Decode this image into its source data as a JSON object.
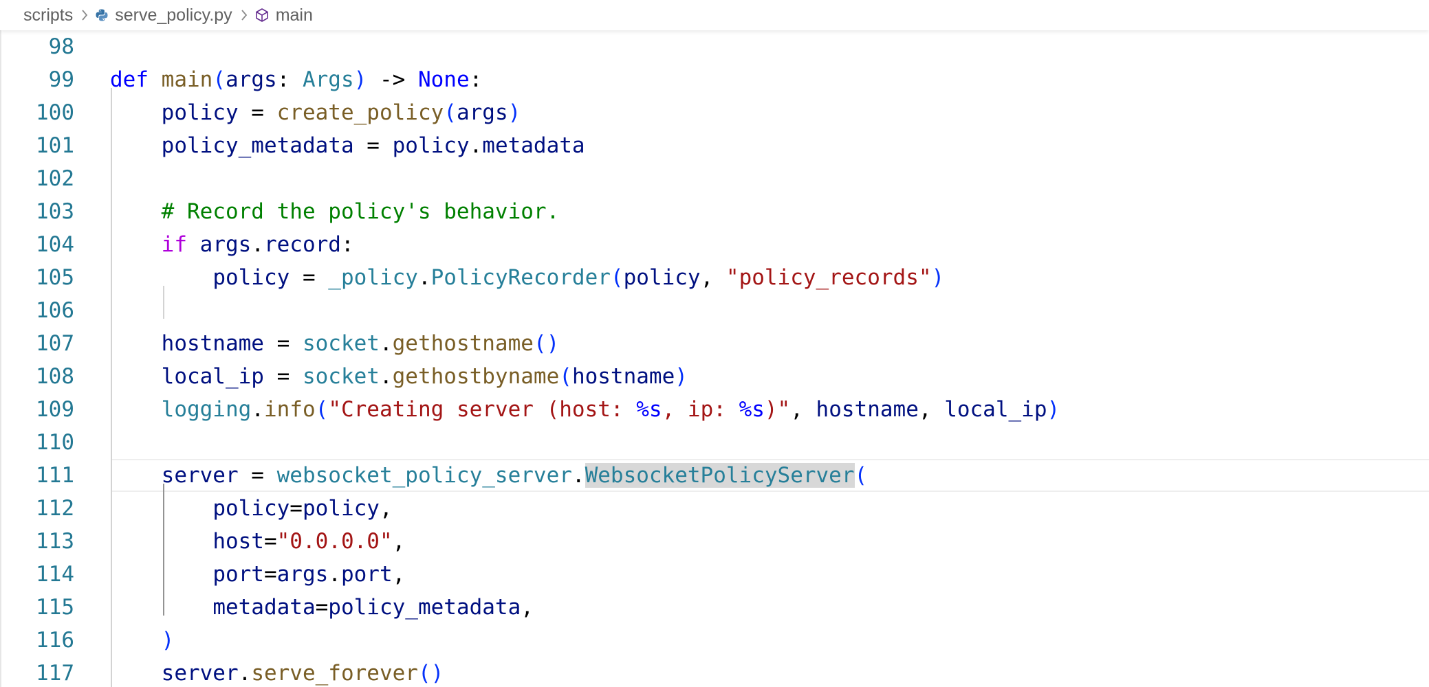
{
  "breadcrumb": {
    "items": [
      {
        "label": "scripts",
        "icon": "folder",
        "icon_glyph": ""
      },
      {
        "label": "serve_policy.py",
        "icon": "python-file-icon"
      },
      {
        "label": "main",
        "icon": "symbol-method-icon"
      }
    ],
    "separator_icon": "chevron-right-icon"
  },
  "editor": {
    "language": "python",
    "current_line": "111",
    "highlighted_token": "WebsocketPolicyServer",
    "colors": {
      "keyword": "#0000ff",
      "control_keyword": "#af00db",
      "function": "#795e26",
      "variable": "#001080",
      "type": "#267f99",
      "string": "#a31515",
      "comment": "#008000",
      "line_number": "#237893"
    },
    "lines": [
      {
        "number": "98",
        "tokens": []
      },
      {
        "number": "99",
        "tokens": [
          {
            "t": "def",
            "c": "kw"
          },
          {
            "t": " ",
            "c": "plain"
          },
          {
            "t": "main",
            "c": "fn"
          },
          {
            "t": "(",
            "c": "b1"
          },
          {
            "t": "args",
            "c": "var"
          },
          {
            "t": ": ",
            "c": "plain"
          },
          {
            "t": "Args",
            "c": "type"
          },
          {
            "t": ")",
            "c": "b1"
          },
          {
            "t": " -> ",
            "c": "plain"
          },
          {
            "t": "None",
            "c": "kw"
          },
          {
            "t": ":",
            "c": "plain"
          }
        ]
      },
      {
        "number": "100",
        "tokens": [
          {
            "t": "    ",
            "c": "plain"
          },
          {
            "t": "policy",
            "c": "var"
          },
          {
            "t": " = ",
            "c": "plain"
          },
          {
            "t": "create_policy",
            "c": "fn"
          },
          {
            "t": "(",
            "c": "b1"
          },
          {
            "t": "args",
            "c": "var"
          },
          {
            "t": ")",
            "c": "b1"
          }
        ]
      },
      {
        "number": "101",
        "tokens": [
          {
            "t": "    ",
            "c": "plain"
          },
          {
            "t": "policy_metadata",
            "c": "var"
          },
          {
            "t": " = ",
            "c": "plain"
          },
          {
            "t": "policy",
            "c": "var"
          },
          {
            "t": ".",
            "c": "plain"
          },
          {
            "t": "metadata",
            "c": "var"
          }
        ]
      },
      {
        "number": "102",
        "tokens": []
      },
      {
        "number": "103",
        "tokens": [
          {
            "t": "    ",
            "c": "plain"
          },
          {
            "t": "# Record the policy's behavior.",
            "c": "cmt"
          }
        ]
      },
      {
        "number": "104",
        "tokens": [
          {
            "t": "    ",
            "c": "plain"
          },
          {
            "t": "if",
            "c": "ctl"
          },
          {
            "t": " ",
            "c": "plain"
          },
          {
            "t": "args",
            "c": "var"
          },
          {
            "t": ".",
            "c": "plain"
          },
          {
            "t": "record",
            "c": "var"
          },
          {
            "t": ":",
            "c": "plain"
          }
        ]
      },
      {
        "number": "105",
        "tokens": [
          {
            "t": "        ",
            "c": "plain"
          },
          {
            "t": "policy",
            "c": "var"
          },
          {
            "t": " = ",
            "c": "plain"
          },
          {
            "t": "_policy",
            "c": "type"
          },
          {
            "t": ".",
            "c": "plain"
          },
          {
            "t": "PolicyRecorder",
            "c": "type"
          },
          {
            "t": "(",
            "c": "b1"
          },
          {
            "t": "policy",
            "c": "var"
          },
          {
            "t": ", ",
            "c": "plain"
          },
          {
            "t": "\"policy_records\"",
            "c": "str"
          },
          {
            "t": ")",
            "c": "b1"
          }
        ]
      },
      {
        "number": "106",
        "tokens": []
      },
      {
        "number": "107",
        "tokens": [
          {
            "t": "    ",
            "c": "plain"
          },
          {
            "t": "hostname",
            "c": "var"
          },
          {
            "t": " = ",
            "c": "plain"
          },
          {
            "t": "socket",
            "c": "type"
          },
          {
            "t": ".",
            "c": "plain"
          },
          {
            "t": "gethostname",
            "c": "fn"
          },
          {
            "t": "()",
            "c": "b1"
          }
        ]
      },
      {
        "number": "108",
        "tokens": [
          {
            "t": "    ",
            "c": "plain"
          },
          {
            "t": "local_ip",
            "c": "var"
          },
          {
            "t": " = ",
            "c": "plain"
          },
          {
            "t": "socket",
            "c": "type"
          },
          {
            "t": ".",
            "c": "plain"
          },
          {
            "t": "gethostbyname",
            "c": "fn"
          },
          {
            "t": "(",
            "c": "b1"
          },
          {
            "t": "hostname",
            "c": "var"
          },
          {
            "t": ")",
            "c": "b1"
          }
        ]
      },
      {
        "number": "109",
        "tokens": [
          {
            "t": "    ",
            "c": "plain"
          },
          {
            "t": "logging",
            "c": "type"
          },
          {
            "t": ".",
            "c": "plain"
          },
          {
            "t": "info",
            "c": "fn"
          },
          {
            "t": "(",
            "c": "b1"
          },
          {
            "t": "\"Creating server (host: ",
            "c": "str"
          },
          {
            "t": "%s",
            "c": "esc"
          },
          {
            "t": ", ip: ",
            "c": "str"
          },
          {
            "t": "%s",
            "c": "esc"
          },
          {
            "t": ")\"",
            "c": "str"
          },
          {
            "t": ", ",
            "c": "plain"
          },
          {
            "t": "hostname",
            "c": "var"
          },
          {
            "t": ", ",
            "c": "plain"
          },
          {
            "t": "local_ip",
            "c": "var"
          },
          {
            "t": ")",
            "c": "b1"
          }
        ]
      },
      {
        "number": "110",
        "tokens": []
      },
      {
        "number": "111",
        "tokens": [
          {
            "t": "    ",
            "c": "plain"
          },
          {
            "t": "server",
            "c": "var"
          },
          {
            "t": " = ",
            "c": "plain"
          },
          {
            "t": "websocket_policy_server",
            "c": "type"
          },
          {
            "t": ".",
            "c": "plain"
          },
          {
            "t": "WebsocketPolicyServer",
            "c": "type hl"
          },
          {
            "t": "(",
            "c": "b1"
          }
        ]
      },
      {
        "number": "112",
        "tokens": [
          {
            "t": "        ",
            "c": "plain"
          },
          {
            "t": "policy",
            "c": "var"
          },
          {
            "t": "=",
            "c": "plain"
          },
          {
            "t": "policy",
            "c": "var"
          },
          {
            "t": ",",
            "c": "plain"
          }
        ]
      },
      {
        "number": "113",
        "tokens": [
          {
            "t": "        ",
            "c": "plain"
          },
          {
            "t": "host",
            "c": "var"
          },
          {
            "t": "=",
            "c": "plain"
          },
          {
            "t": "\"0.0.0.0\"",
            "c": "str"
          },
          {
            "t": ",",
            "c": "plain"
          }
        ]
      },
      {
        "number": "114",
        "tokens": [
          {
            "t": "        ",
            "c": "plain"
          },
          {
            "t": "port",
            "c": "var"
          },
          {
            "t": "=",
            "c": "plain"
          },
          {
            "t": "args",
            "c": "var"
          },
          {
            "t": ".",
            "c": "plain"
          },
          {
            "t": "port",
            "c": "var"
          },
          {
            "t": ",",
            "c": "plain"
          }
        ]
      },
      {
        "number": "115",
        "tokens": [
          {
            "t": "        ",
            "c": "plain"
          },
          {
            "t": "metadata",
            "c": "var"
          },
          {
            "t": "=",
            "c": "plain"
          },
          {
            "t": "policy_metadata",
            "c": "var"
          },
          {
            "t": ",",
            "c": "plain"
          }
        ]
      },
      {
        "number": "116",
        "tokens": [
          {
            "t": "    ",
            "c": "plain"
          },
          {
            "t": ")",
            "c": "b1"
          }
        ]
      },
      {
        "number": "117",
        "tokens": [
          {
            "t": "    ",
            "c": "plain"
          },
          {
            "t": "server",
            "c": "var"
          },
          {
            "t": ".",
            "c": "plain"
          },
          {
            "t": "serve_forever",
            "c": "fn"
          },
          {
            "t": "()",
            "c": "b1"
          }
        ]
      }
    ]
  }
}
